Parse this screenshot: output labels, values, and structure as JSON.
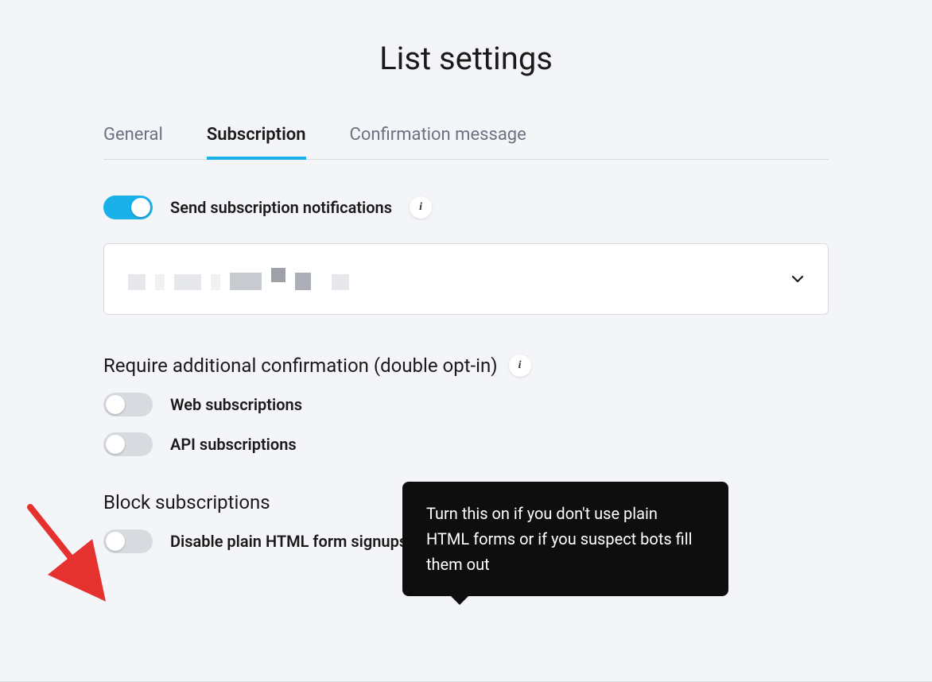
{
  "page_title": "List settings",
  "tabs": {
    "general": "General",
    "subscription": "Subscription",
    "confirmation": "Confirmation message",
    "active": "subscription"
  },
  "settings": {
    "send_notifications": {
      "label": "Send subscription notifications",
      "on": true
    },
    "require_confirmation": {
      "title": "Require additional confirmation (double opt-in)",
      "web": {
        "label": "Web subscriptions",
        "on": false
      },
      "api": {
        "label": "API subscriptions",
        "on": false
      }
    },
    "block_subscriptions": {
      "title": "Block subscriptions",
      "disable_html": {
        "label": "Disable plain HTML form signups",
        "on": false
      }
    }
  },
  "tooltip": {
    "text": "Turn this on if you don't use plain HTML forms or if you suspect bots fill them out"
  },
  "info_glyph": "i"
}
